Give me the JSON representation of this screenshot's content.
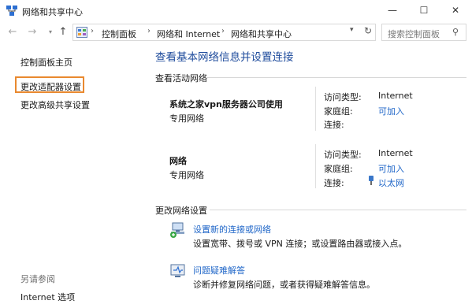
{
  "window": {
    "title": "网络和共享中心",
    "controls": {
      "minimize": "—",
      "maximize": "☐",
      "close": "✕"
    }
  },
  "navigation": {
    "breadcrumbs": [
      "控制面板",
      "网络和 Internet",
      "网络和共享中心"
    ],
    "search_placeholder": "搜索控制面板"
  },
  "sidebar": {
    "links": [
      "控制面板主页",
      "更改适配器设置",
      "更改高级共享设置"
    ],
    "highlighted": "更改适配器设置",
    "see_also_label": "另请参阅",
    "see_also_links": [
      "Internet 选项"
    ]
  },
  "main": {
    "title": "查看基本网络信息并设置连接",
    "active_networks_label": "查看活动网络",
    "networks": [
      {
        "name": "系统之家vpn服务器公司使用",
        "type": "专用网络",
        "access_type_label": "访问类型:",
        "access_type": "Internet",
        "homegroup_label": "家庭组:",
        "homegroup": "可加入",
        "connection_label": "连接:",
        "connection": ""
      },
      {
        "name": "网络",
        "type": "专用网络",
        "access_type_label": "访问类型:",
        "access_type": "Internet",
        "homegroup_label": "家庭组:",
        "homegroup": "可加入",
        "connection_label": "连接:",
        "connection": "以太网"
      }
    ],
    "change_settings_label": "更改网络设置",
    "tasks": [
      {
        "link": "设置新的连接或网络",
        "description": "设置宽带、拨号或 VPN 连接；或设置路由器或接入点。"
      },
      {
        "link": "问题疑难解答",
        "description": "诊断并修复网络问题，或者获得疑难解答信息。"
      }
    ]
  },
  "colors": {
    "link": "#1f66c8",
    "title": "#1e4b9c",
    "highlight_border": "#e9892f"
  }
}
